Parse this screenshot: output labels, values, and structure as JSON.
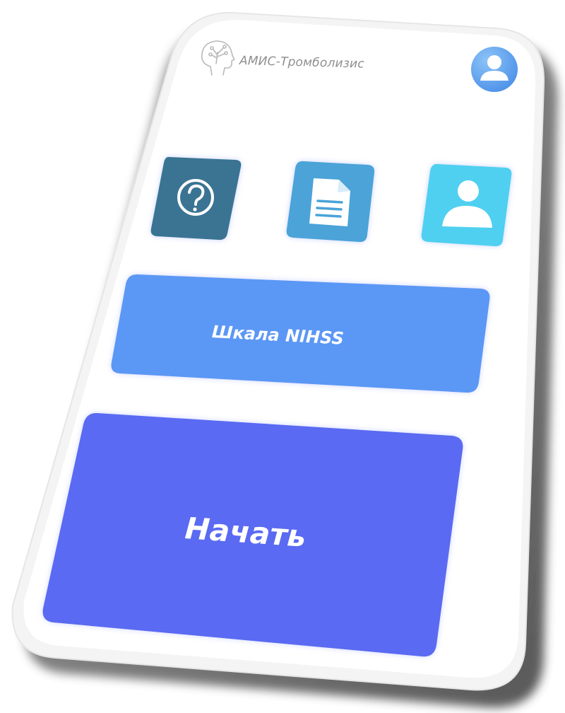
{
  "header": {
    "app_title": "АМИС-Тромболизис",
    "logo_icon": "head-with-brain-tree-icon",
    "profile_icon": "user-profile-icon"
  },
  "tiles": [
    {
      "icon": "question-icon",
      "color": "#3b7493"
    },
    {
      "icon": "document-icon",
      "color": "#4ba3d8"
    },
    {
      "icon": "user-icon",
      "color": "#4fd0f0"
    }
  ],
  "actions": {
    "nihss_label": "Шкала NIHSS",
    "start_label": "Начать"
  },
  "colors": {
    "nihss_button": "#5b97f5",
    "start_button": "#5a6af2",
    "profile_avatar": "#5fa6f0"
  }
}
